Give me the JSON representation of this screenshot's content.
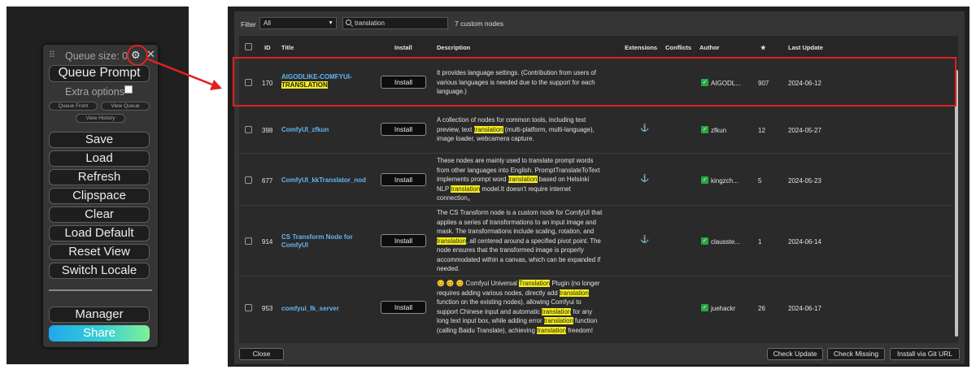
{
  "menu": {
    "queue_size": "Queue size: 0",
    "queue_prompt": "Queue Prompt",
    "extra_options": "Extra options",
    "queue_front": "Queue Front",
    "view_queue": "View Queue",
    "view_history": "View History",
    "buttons": [
      "Save",
      "Load",
      "Refresh",
      "Clipspace",
      "Clear",
      "Load Default",
      "Reset View",
      "Switch Locale"
    ],
    "manager": "Manager",
    "share": "Share"
  },
  "manager": {
    "filter_label": "Filter",
    "filter_value": "All",
    "search_value": "translation",
    "count_text": "7 custom nodes",
    "columns": {
      "id": "ID",
      "title": "Title",
      "install": "Install",
      "description": "Description",
      "extensions": "Extensions",
      "conflicts": "Conflicts",
      "author": "Author",
      "stars": "★",
      "last_update": "Last Update"
    },
    "install_label": "Install",
    "rows": [
      {
        "id": "170",
        "title_line1": "AIGODLIKE-COMFYUI-",
        "title_line2": "TRANSLATION",
        "desc": [
          "It provides language settings. (Contribution from users of",
          "various languages is needed due to the support for each",
          "language.)"
        ],
        "author": "AIGODL...",
        "stars": "907",
        "updated": "2024-06-12"
      },
      {
        "id": "398",
        "title_line1": "ComfyUI_zfkun",
        "title_line2": "",
        "desc_a": "A collection of nodes for common tools, including text",
        "desc_b_pre": "preview, text ",
        "desc_b_hl": "translation",
        "desc_b_post": " (multi-platform, multi-language),",
        "desc_c": "image loader, webcamera capture.",
        "author": "zfkun",
        "stars": "12",
        "updated": "2024-05-27"
      },
      {
        "id": "677",
        "title_line1": "ComfyUI_kkTranslator_nod",
        "title_line2": "",
        "desc_a": "These nodes are mainly used to translate prompt words",
        "desc_b": "from other languages into English. PromptTranslateToText",
        "desc_c_pre": "implements prompt word ",
        "desc_c_hl": "translation",
        "desc_c_post": " based on Helsinki",
        "desc_d_pre": "NLP ",
        "desc_d_hl": "translation",
        "desc_d_post": " model.It doesn't require internet",
        "desc_e": "connection。",
        "author": "kingzch...",
        "stars": "5",
        "updated": "2024-05-23"
      },
      {
        "id": "914",
        "title_line1": "CS Transform Node for",
        "title_line2": "ComfyUI",
        "desc_a": "The CS Transform node is a custom node for ComfyUI that",
        "desc_b": "applies a series of transformations to an input image and",
        "desc_c": "mask. The transformations include scaling, rotation, and",
        "desc_d_hl": "translation",
        "desc_d_post": ", all centered around a specified pivot point. The",
        "desc_e": "node ensures that the transformed image is properly",
        "desc_f": "accommodated within a canvas, which can be expanded if",
        "desc_g": "needed.",
        "author": "clausste...",
        "stars": "1",
        "updated": "2024-06-14"
      },
      {
        "id": "953",
        "title_line1": "comfyui_fk_server",
        "title_line2": "",
        "desc_a_pre": "😊 😊 😊 Comfyui Universal ",
        "desc_a_hl": "Translation",
        "desc_a_post": " Plugin (no longer",
        "desc_b_pre": "requires adding various nodes, directly add ",
        "desc_b_hl": "translation",
        "desc_c": "function on the existing nodes), allowing Comfyui to",
        "desc_d_pre": "support Chinese input and automatic ",
        "desc_d_hl": "translation",
        "desc_d_post": " for any",
        "desc_e_pre": "long text input box, while adding error ",
        "desc_e_hl": "translation",
        "desc_e_post": " function",
        "desc_f_pre": "(calling Baidu Translate), achieving ",
        "desc_f_hl": "translation",
        "desc_f_post": " freedom!",
        "author": "juehackr",
        "stars": "26",
        "updated": "2024-06-17"
      }
    ],
    "footer": {
      "close": "Close",
      "check_update": "Check Update",
      "check_missing": "Check Missing",
      "install_git": "Install via Git URL"
    }
  },
  "colors": {
    "highlight": "#f5ee1b",
    "annotation_red": "#e32020",
    "title_link": "#62b5f2",
    "share_gradient": [
      "#1fa7ef",
      "#7ff09a"
    ]
  }
}
